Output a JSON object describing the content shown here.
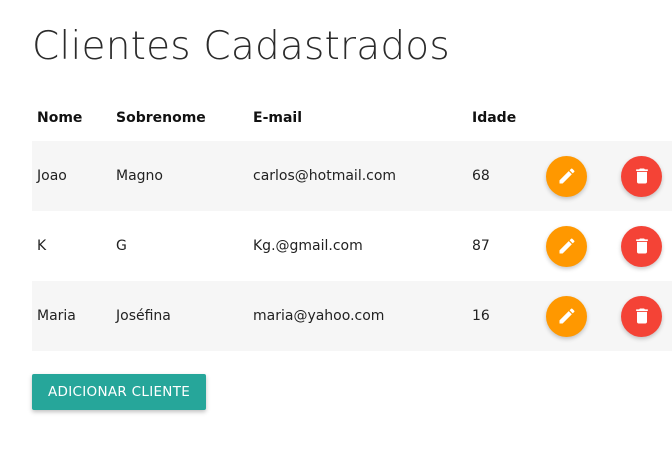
{
  "page": {
    "title": "Clientes Cadastrados"
  },
  "table": {
    "headers": {
      "nome": "Nome",
      "sobrenome": "Sobrenome",
      "email": "E-mail",
      "idade": "Idade"
    },
    "rows": [
      {
        "nome": "Joao",
        "sobrenome": "Magno",
        "email": "carlos@hotmail.com",
        "idade": "68"
      },
      {
        "nome": "K",
        "sobrenome": "G",
        "email": "Kg.@gmail.com",
        "idade": "87"
      },
      {
        "nome": "Maria",
        "sobrenome": "Joséfina",
        "email": "maria@yahoo.com",
        "idade": "16"
      }
    ],
    "row_actions": {
      "edit_icon": "pencil-icon",
      "delete_icon": "trash-icon"
    }
  },
  "actions": {
    "add_label": "ADICIONAR CLIENTE"
  },
  "colors": {
    "edit": "#ff9800",
    "delete": "#f44336",
    "primary": "#26a69a",
    "stripe": "#f6f6f6"
  }
}
